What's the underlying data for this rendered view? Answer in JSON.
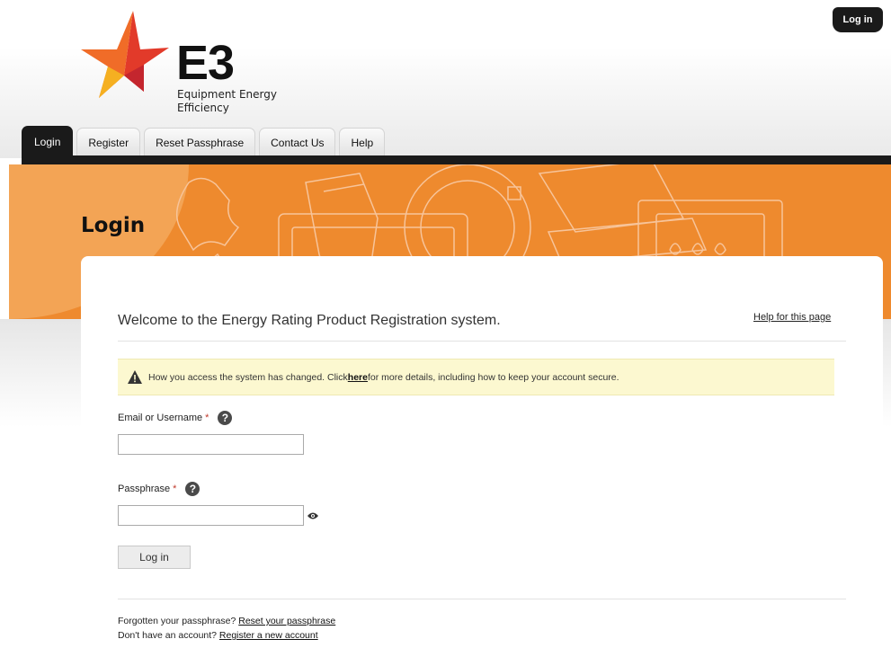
{
  "header": {
    "login_button": "Log in",
    "logo": {
      "mark": "E3",
      "subtitle_line1": "Equipment Energy",
      "subtitle_line2": "Efficiency"
    }
  },
  "nav": {
    "tabs": [
      {
        "label": "Login",
        "active": true
      },
      {
        "label": "Register",
        "active": false
      },
      {
        "label": "Reset Passphrase",
        "active": false
      },
      {
        "label": "Contact Us",
        "active": false
      },
      {
        "label": "Help",
        "active": false
      }
    ]
  },
  "page": {
    "title": "Login",
    "welcome": "Welcome to the Energy Rating Product Registration system.",
    "help_link": "Help for this page"
  },
  "notice": {
    "text_before": "How you access the system has changed. Click ",
    "link": "here",
    "text_after": " for more details, including how to keep your account secure."
  },
  "form": {
    "email_label": "Email or Username",
    "email_value": "",
    "passphrase_label": "Passphrase",
    "passphrase_value": "",
    "required_mark": "*",
    "help_glyph": "?",
    "submit_label": "Log in"
  },
  "footer": {
    "forgot_text": "Forgotten your passphrase? ",
    "forgot_link": "Reset your passphrase",
    "account_text": "Don't have an account? ",
    "account_link": "Register a new account"
  },
  "colors": {
    "brand_orange": "#ee8a2e",
    "nav_dark": "#1a1a1a",
    "notice_bg": "#fcf8d0",
    "required_red": "#c0392b"
  }
}
